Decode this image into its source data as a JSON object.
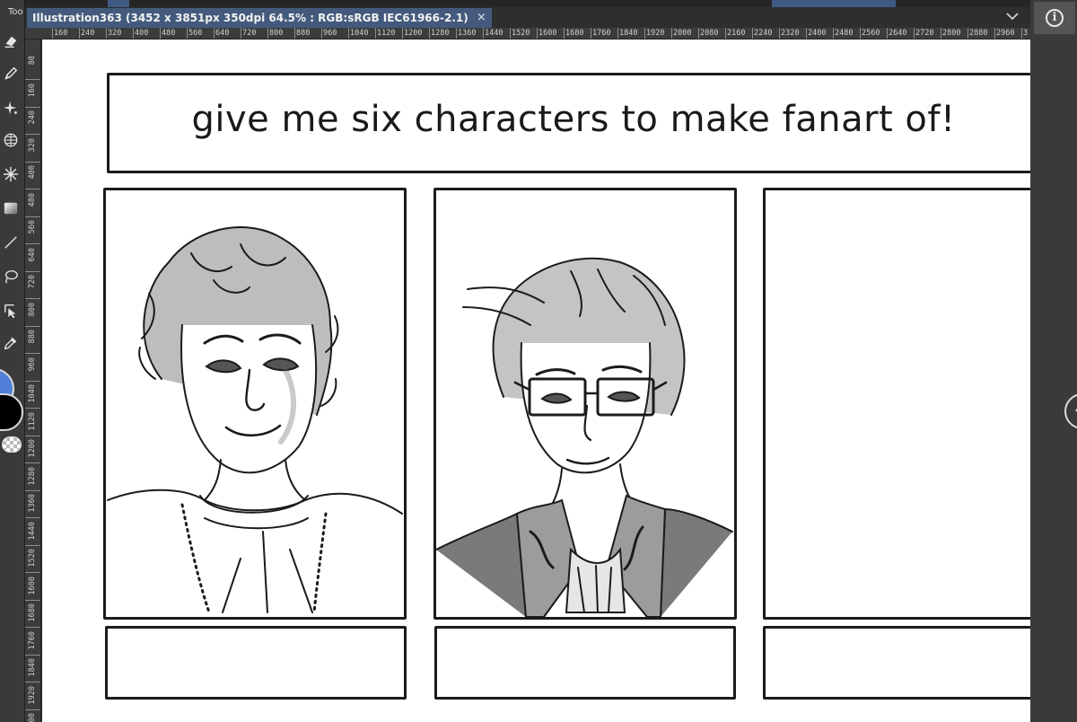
{
  "tool_panel": {
    "header": "Too",
    "tools": [
      {
        "icon": "eraser-icon"
      },
      {
        "icon": "pen-icon"
      },
      {
        "icon": "sparkle-icon"
      },
      {
        "icon": "perspective-grid-icon"
      },
      {
        "icon": "star-burst-icon"
      },
      {
        "icon": "gradient-icon"
      },
      {
        "icon": "line-icon"
      },
      {
        "icon": "lasso-icon"
      },
      {
        "icon": "object-select-icon"
      },
      {
        "icon": "eyedropper-icon"
      }
    ],
    "colors": {
      "main": "#4f7fd6",
      "sub": "#000000"
    }
  },
  "tab": {
    "title": "Illustration363 (3452 x 3851px 350dpi 64.5% : RGB:sRGB IEC61966-2.1)",
    "close_label": "×"
  },
  "ruler": {
    "h_labels": [
      "160",
      "240",
      "320",
      "400",
      "480",
      "560",
      "640",
      "720",
      "800",
      "880",
      "960",
      "1040",
      "1120",
      "1200",
      "1280",
      "1360",
      "1440",
      "1520",
      "1600",
      "1680",
      "1760",
      "1840",
      "1920",
      "2000",
      "2080",
      "2160",
      "2240",
      "2320",
      "2400",
      "2480",
      "2560",
      "2640",
      "2720",
      "2800",
      "2880",
      "2960",
      "3"
    ],
    "v_labels": [
      "80",
      "160",
      "240",
      "320",
      "400",
      "480",
      "560",
      "640",
      "720",
      "800",
      "880",
      "960",
      "1040",
      "1120",
      "1200",
      "1280",
      "1360",
      "1440",
      "1520",
      "1600",
      "1680",
      "1760",
      "1840",
      "1920",
      "000"
    ]
  },
  "canvas": {
    "title": "give me six characters to make fanart of!",
    "portraits": [
      {
        "name": "portrait-curly-hair-man",
        "ink": "#1b1b1b"
      },
      {
        "name": "portrait-glasses-man",
        "ink": "#1b1b1b"
      },
      {
        "name": "portrait-empty",
        "ink": "#1b1b1b"
      }
    ]
  },
  "right_panel": {
    "info_icon": "info-icon",
    "handle_icon": "chevron-left-icon"
  }
}
